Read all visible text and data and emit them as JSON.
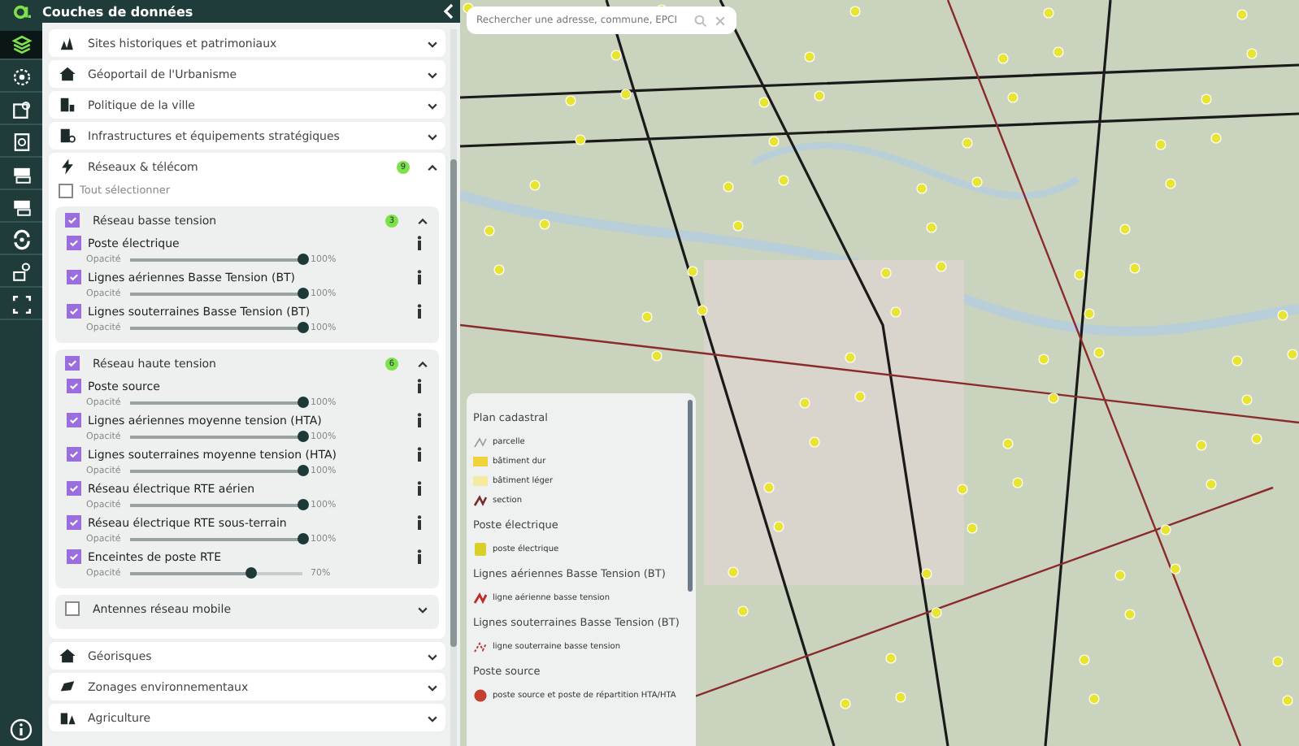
{
  "header": {
    "title": "Couches de données"
  },
  "rail": [
    {
      "selected": true
    },
    {
      "selected": false
    },
    {
      "selected": false
    },
    {
      "selected": false
    },
    {
      "selected": false
    },
    {
      "selected": false
    },
    {
      "selected": false
    },
    {
      "selected": false
    },
    {
      "selected": false
    }
  ],
  "categories": [
    {
      "label": "Sites historiques et patrimoniaux",
      "expanded": false
    },
    {
      "label": "Géoportail de l'Urbanisme",
      "expanded": false
    },
    {
      "label": "Politique de la ville",
      "expanded": false
    },
    {
      "label": "Infrastructures et équipements stratégiques",
      "expanded": false
    },
    {
      "label": "Réseaux & télécom",
      "expanded": true,
      "badge": "9",
      "select_all": {
        "label": "Tout sélectionner",
        "checked": false
      },
      "groups": [
        {
          "label": "Réseau basse tension",
          "checked": true,
          "badge": "3",
          "expanded": true,
          "layers": [
            {
              "label": "Poste électrique",
              "checked": true,
              "opacity_label": "Opacité",
              "level": 1,
              "reading": "100%"
            },
            {
              "label": "Lignes aériennes Basse Tension (BT)",
              "checked": true,
              "opacity_label": "Opacité",
              "level": 1,
              "reading": "100%"
            },
            {
              "label": "Lignes souterraines Basse Tension (BT)",
              "checked": true,
              "opacity_label": "Opacité",
              "level": 1,
              "reading": "100%"
            }
          ]
        },
        {
          "label": "Réseau haute tension",
          "checked": true,
          "badge": "6",
          "expanded": true,
          "layers": [
            {
              "label": "Poste source",
              "checked": true,
              "opacity_label": "Opacité",
              "level": 1,
              "reading": "100%"
            },
            {
              "label": "Lignes aériennes moyenne tension (HTA)",
              "checked": true,
              "opacity_label": "Opacité",
              "level": 1,
              "reading": "100%"
            },
            {
              "label": "Lignes souterraines moyenne tension (HTA)",
              "checked": true,
              "opacity_label": "Opacité",
              "level": 1,
              "reading": "100%"
            },
            {
              "label": "Réseau électrique RTE aérien",
              "checked": true,
              "opacity_label": "Opacité",
              "level": 1,
              "reading": "100%"
            },
            {
              "label": "Réseau électrique RTE sous-terrain",
              "checked": true,
              "opacity_label": "Opacité",
              "level": 1,
              "reading": "100%"
            },
            {
              "label": "Enceintes de poste RTE",
              "checked": true,
              "opacity_label": "Opacité",
              "level": 0.7,
              "reading": "70%"
            }
          ]
        },
        {
          "label": "Antennes réseau mobile",
          "checked": false,
          "expanded": false
        }
      ]
    },
    {
      "label": "Géorisques",
      "expanded": false
    },
    {
      "label": "Zonages environnementaux",
      "expanded": false
    },
    {
      "label": "Agriculture",
      "expanded": false
    }
  ],
  "search": {
    "placeholder": "Rechercher une adresse, commune, EPCI"
  },
  "legend": [
    {
      "title": "Plan cadastral",
      "entries": [
        {
          "label": "parcelle",
          "kind": "thin-line"
        },
        {
          "label": "bâtiment dur",
          "kind": "solid-fill"
        },
        {
          "label": "bâtiment léger",
          "kind": "light-fill"
        },
        {
          "label": "section",
          "kind": "bold-line"
        }
      ]
    },
    {
      "title": "Poste électrique",
      "entries": [
        {
          "label": "poste électrique",
          "kind": "station"
        }
      ]
    },
    {
      "title": "Lignes aériennes Basse Tension (BT)",
      "entries": [
        {
          "label": "ligne aérienne basse tension",
          "kind": "red-line"
        }
      ]
    },
    {
      "title": "Lignes souterraines Basse Tension (BT)",
      "entries": [
        {
          "label": "ligne souterraine basse tension",
          "kind": "dashed-line"
        }
      ]
    },
    {
      "title": "Poste source",
      "entries": [
        {
          "label": "poste source et poste de répartition HTA/HTA",
          "kind": "source"
        }
      ]
    }
  ]
}
